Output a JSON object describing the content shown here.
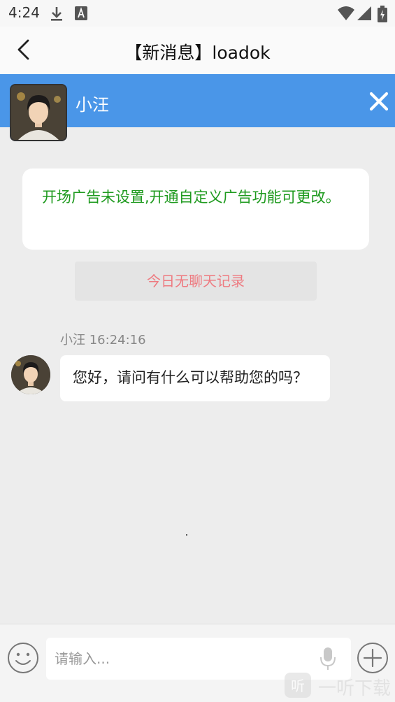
{
  "status_bar": {
    "time": "4:24",
    "icons": [
      "download-icon",
      "a-badge-icon",
      "wifi-icon",
      "signal-icon",
      "battery-icon"
    ]
  },
  "nav": {
    "title": "【新消息】loadok",
    "back_icon": "chevron-left-icon"
  },
  "contact": {
    "name": "小汪",
    "close_icon": "close-icon"
  },
  "ad_notice": {
    "text": "开场广告未设置,开通自定义广告功能可更改。"
  },
  "no_record": "今日无聊天记录",
  "message": {
    "sender": "小汪",
    "time": "16:24:16",
    "text": "您好，请问有什么可以帮助您的吗？"
  },
  "composer": {
    "placeholder": "请输入...",
    "emoji_icon": "emoji-icon",
    "mic_icon": "mic-icon",
    "plus_icon": "plus-icon"
  },
  "watermark": {
    "text": "一听下载"
  },
  "colors": {
    "contact_bar": "#4a96e8",
    "ad_text": "#1e9a1e",
    "no_record_text": "#ee7a80",
    "background": "#ededed"
  }
}
